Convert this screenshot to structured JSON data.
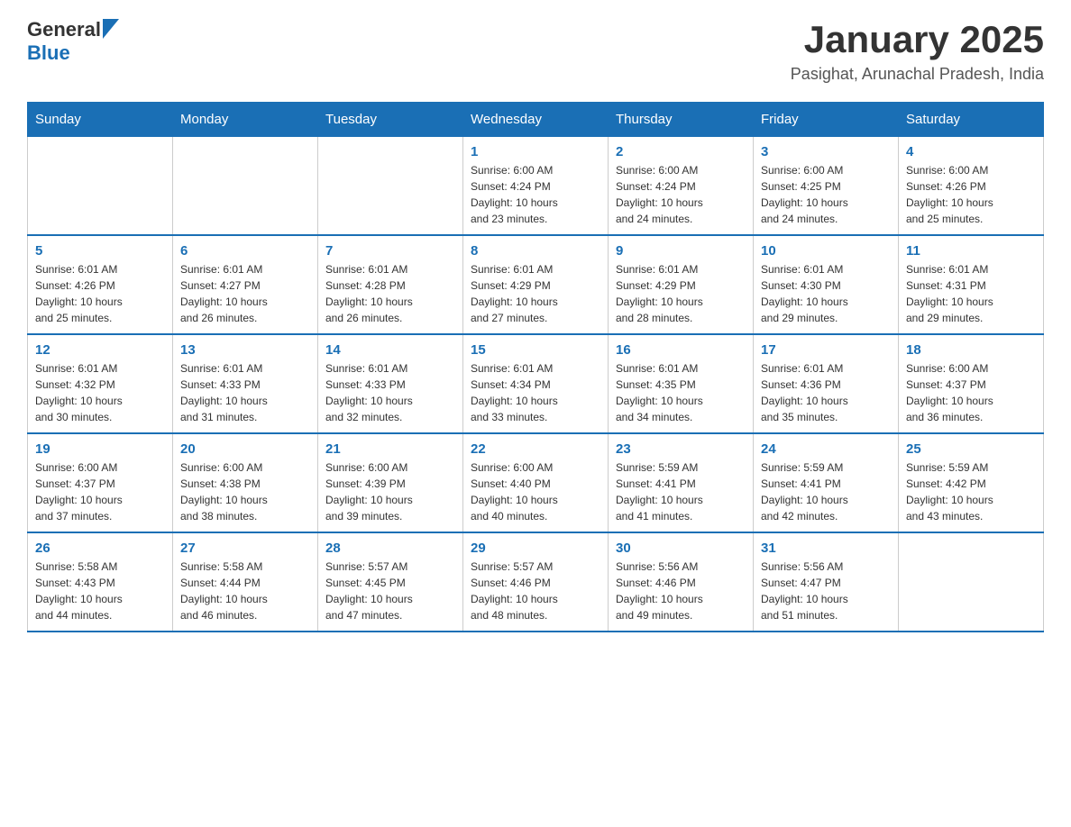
{
  "header": {
    "logo_general": "General",
    "logo_blue": "Blue",
    "month_year": "January 2025",
    "location": "Pasighat, Arunachal Pradesh, India"
  },
  "days_of_week": [
    "Sunday",
    "Monday",
    "Tuesday",
    "Wednesday",
    "Thursday",
    "Friday",
    "Saturday"
  ],
  "weeks": [
    [
      {
        "day": "",
        "info": ""
      },
      {
        "day": "",
        "info": ""
      },
      {
        "day": "",
        "info": ""
      },
      {
        "day": "1",
        "info": "Sunrise: 6:00 AM\nSunset: 4:24 PM\nDaylight: 10 hours\nand 23 minutes."
      },
      {
        "day": "2",
        "info": "Sunrise: 6:00 AM\nSunset: 4:24 PM\nDaylight: 10 hours\nand 24 minutes."
      },
      {
        "day": "3",
        "info": "Sunrise: 6:00 AM\nSunset: 4:25 PM\nDaylight: 10 hours\nand 24 minutes."
      },
      {
        "day": "4",
        "info": "Sunrise: 6:00 AM\nSunset: 4:26 PM\nDaylight: 10 hours\nand 25 minutes."
      }
    ],
    [
      {
        "day": "5",
        "info": "Sunrise: 6:01 AM\nSunset: 4:26 PM\nDaylight: 10 hours\nand 25 minutes."
      },
      {
        "day": "6",
        "info": "Sunrise: 6:01 AM\nSunset: 4:27 PM\nDaylight: 10 hours\nand 26 minutes."
      },
      {
        "day": "7",
        "info": "Sunrise: 6:01 AM\nSunset: 4:28 PM\nDaylight: 10 hours\nand 26 minutes."
      },
      {
        "day": "8",
        "info": "Sunrise: 6:01 AM\nSunset: 4:29 PM\nDaylight: 10 hours\nand 27 minutes."
      },
      {
        "day": "9",
        "info": "Sunrise: 6:01 AM\nSunset: 4:29 PM\nDaylight: 10 hours\nand 28 minutes."
      },
      {
        "day": "10",
        "info": "Sunrise: 6:01 AM\nSunset: 4:30 PM\nDaylight: 10 hours\nand 29 minutes."
      },
      {
        "day": "11",
        "info": "Sunrise: 6:01 AM\nSunset: 4:31 PM\nDaylight: 10 hours\nand 29 minutes."
      }
    ],
    [
      {
        "day": "12",
        "info": "Sunrise: 6:01 AM\nSunset: 4:32 PM\nDaylight: 10 hours\nand 30 minutes."
      },
      {
        "day": "13",
        "info": "Sunrise: 6:01 AM\nSunset: 4:33 PM\nDaylight: 10 hours\nand 31 minutes."
      },
      {
        "day": "14",
        "info": "Sunrise: 6:01 AM\nSunset: 4:33 PM\nDaylight: 10 hours\nand 32 minutes."
      },
      {
        "day": "15",
        "info": "Sunrise: 6:01 AM\nSunset: 4:34 PM\nDaylight: 10 hours\nand 33 minutes."
      },
      {
        "day": "16",
        "info": "Sunrise: 6:01 AM\nSunset: 4:35 PM\nDaylight: 10 hours\nand 34 minutes."
      },
      {
        "day": "17",
        "info": "Sunrise: 6:01 AM\nSunset: 4:36 PM\nDaylight: 10 hours\nand 35 minutes."
      },
      {
        "day": "18",
        "info": "Sunrise: 6:00 AM\nSunset: 4:37 PM\nDaylight: 10 hours\nand 36 minutes."
      }
    ],
    [
      {
        "day": "19",
        "info": "Sunrise: 6:00 AM\nSunset: 4:37 PM\nDaylight: 10 hours\nand 37 minutes."
      },
      {
        "day": "20",
        "info": "Sunrise: 6:00 AM\nSunset: 4:38 PM\nDaylight: 10 hours\nand 38 minutes."
      },
      {
        "day": "21",
        "info": "Sunrise: 6:00 AM\nSunset: 4:39 PM\nDaylight: 10 hours\nand 39 minutes."
      },
      {
        "day": "22",
        "info": "Sunrise: 6:00 AM\nSunset: 4:40 PM\nDaylight: 10 hours\nand 40 minutes."
      },
      {
        "day": "23",
        "info": "Sunrise: 5:59 AM\nSunset: 4:41 PM\nDaylight: 10 hours\nand 41 minutes."
      },
      {
        "day": "24",
        "info": "Sunrise: 5:59 AM\nSunset: 4:41 PM\nDaylight: 10 hours\nand 42 minutes."
      },
      {
        "day": "25",
        "info": "Sunrise: 5:59 AM\nSunset: 4:42 PM\nDaylight: 10 hours\nand 43 minutes."
      }
    ],
    [
      {
        "day": "26",
        "info": "Sunrise: 5:58 AM\nSunset: 4:43 PM\nDaylight: 10 hours\nand 44 minutes."
      },
      {
        "day": "27",
        "info": "Sunrise: 5:58 AM\nSunset: 4:44 PM\nDaylight: 10 hours\nand 46 minutes."
      },
      {
        "day": "28",
        "info": "Sunrise: 5:57 AM\nSunset: 4:45 PM\nDaylight: 10 hours\nand 47 minutes."
      },
      {
        "day": "29",
        "info": "Sunrise: 5:57 AM\nSunset: 4:46 PM\nDaylight: 10 hours\nand 48 minutes."
      },
      {
        "day": "30",
        "info": "Sunrise: 5:56 AM\nSunset: 4:46 PM\nDaylight: 10 hours\nand 49 minutes."
      },
      {
        "day": "31",
        "info": "Sunrise: 5:56 AM\nSunset: 4:47 PM\nDaylight: 10 hours\nand 51 minutes."
      },
      {
        "day": "",
        "info": ""
      }
    ]
  ]
}
